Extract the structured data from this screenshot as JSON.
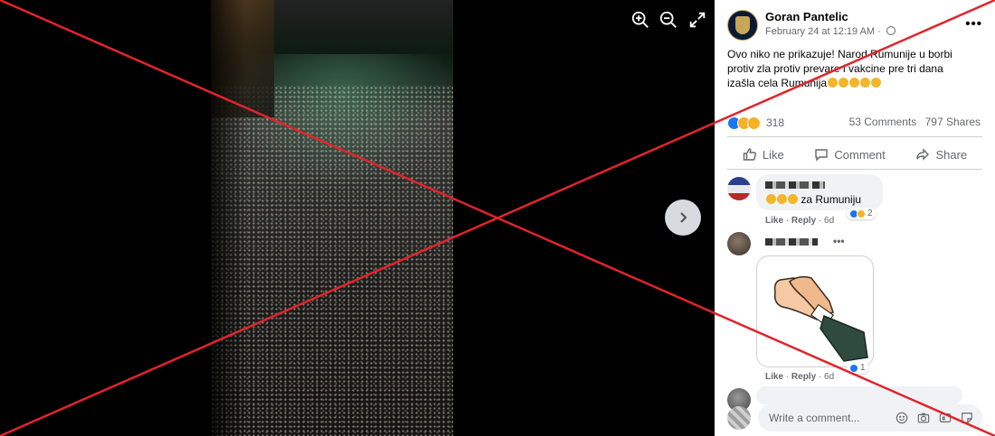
{
  "viewer": {
    "zoom_in_icon": "zoom-in-icon",
    "zoom_out_icon": "zoom-out-icon",
    "fullscreen_icon": "expand-icon",
    "next_icon": "chevron-right-icon"
  },
  "post": {
    "author": "Goran Pantelic",
    "time": "February 24 at 12:19 AM · ",
    "text_line1": "Ovo niko ne prikazuje! Narod Rumunije u borbi",
    "text_line2": "protiv zla protiv prevare i vakcine pre tri dana",
    "text_line3": "izašla cela Rumunija",
    "reaction_count": "318",
    "comments_count": "53 Comments",
    "shares_count": "797 Shares"
  },
  "actions": {
    "like": "Like",
    "comment": "Comment",
    "share": "Share"
  },
  "comments": [
    {
      "text": "za Rumuniju",
      "like": "Like",
      "reply": "Reply",
      "age": "6d",
      "reaction_count": "2"
    },
    {
      "like": "Like",
      "reply": "Reply",
      "age": "6d",
      "reaction_count": "1"
    }
  ],
  "composer": {
    "placeholder": "Write a comment..."
  },
  "colors": {
    "facebook_blue": "#1877f2",
    "overlay_red": "#e0242b",
    "panel_bg": "#ffffff",
    "viewer_bg": "#000000"
  }
}
